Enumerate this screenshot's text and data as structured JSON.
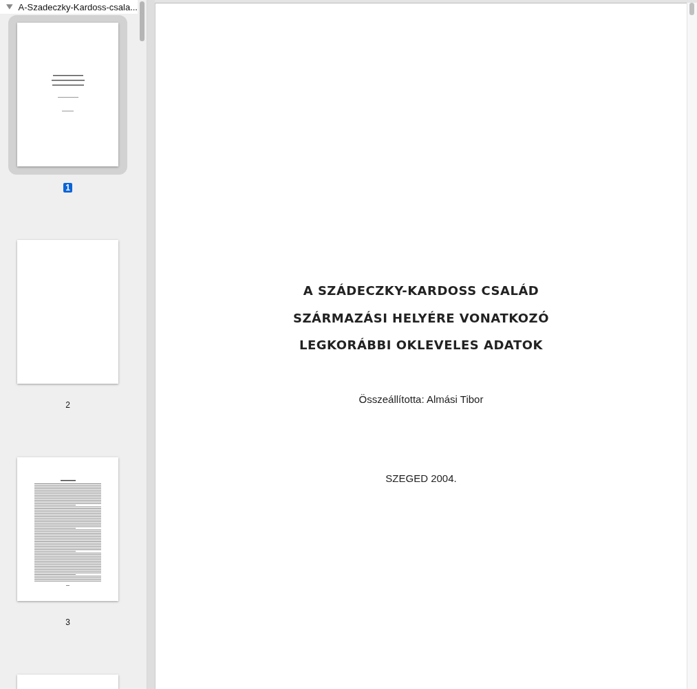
{
  "sidebar": {
    "title": "A-Szadeczky-Kardoss-csala...",
    "expanded": true,
    "pages": [
      {
        "label": "1",
        "selected": true,
        "kind": "title"
      },
      {
        "label": "2",
        "selected": false,
        "kind": "blank"
      },
      {
        "label": "3",
        "selected": false,
        "kind": "text"
      },
      {
        "selected": false,
        "kind": "blank"
      }
    ]
  },
  "document": {
    "title_lines": [
      "A SZÁDECZKY-KARDOSS CSALÁD",
      "SZÁRMAZÁSI HELYÉRE VONATKOZÓ",
      "LEGKORÁBBI OKLEVELES ADATOK"
    ],
    "compiled_by": "Összeállította: Almási Tibor",
    "place_date": "SZEGED 2004."
  }
}
